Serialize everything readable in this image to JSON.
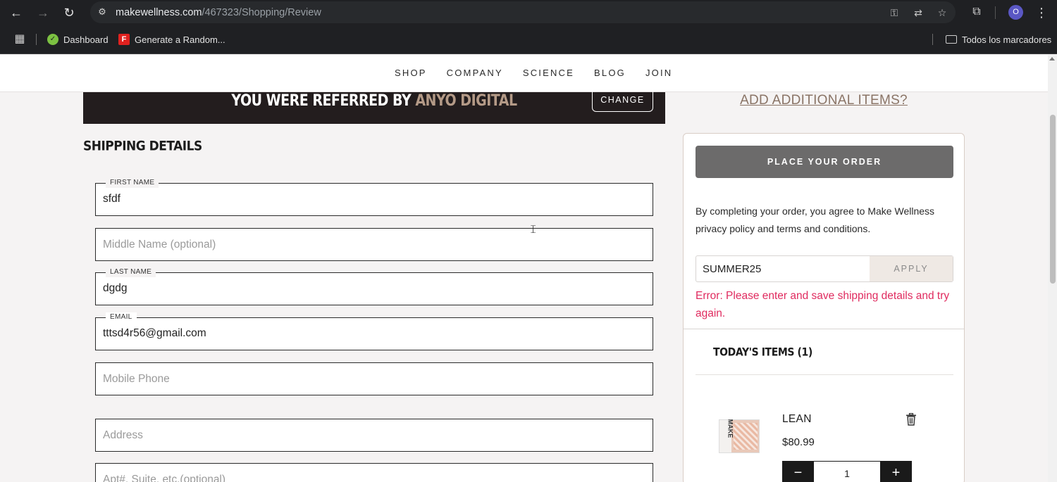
{
  "browser": {
    "url_host": "makewellness.com",
    "url_path": "/467323/Shopping/Review",
    "avatar_letter": "O",
    "bookmarks": [
      {
        "label": "Dashboard"
      },
      {
        "label": "Generate a Random..."
      }
    ],
    "bookmark_folder": "Todos los marcadores"
  },
  "site_nav": {
    "links": [
      "SHOP",
      "COMPANY",
      "SCIENCE",
      "BLOG",
      "JOIN"
    ]
  },
  "referral": {
    "prefix": "YOU WERE REFERRED BY ",
    "name": "ANYO DIGITAL",
    "change_label": "CHANGE"
  },
  "shipping": {
    "title": "SHIPPING DETAILS",
    "first_name_label": "FIRST NAME",
    "first_name_value": "sfdf",
    "middle_name_placeholder": "Middle Name (optional)",
    "last_name_label": "LAST NAME",
    "last_name_value": "dgdg",
    "email_label": "EMAIL",
    "email_value": "tttsd4r56@gmail.com",
    "mobile_placeholder": "Mobile Phone",
    "address_placeholder": "Address",
    "apt_placeholder": "Apt#, Suite, etc.(optional)"
  },
  "order": {
    "add_items_label": "ADD ADDITIONAL ITEMS?",
    "place_order_label": "PLACE YOUR ORDER",
    "agreement_text": "By completing your order, you agree to Make Wellness privacy policy and terms and conditions.",
    "promo_code": "SUMMER25",
    "apply_label": "APPLY",
    "error_text": "Error: Please enter and save shipping details and try again.",
    "items_title": "TODAY'S ITEMS (1)",
    "items": [
      {
        "name": "LEAN",
        "price": "$80.99",
        "quantity": "1",
        "package_text": "MAKE"
      }
    ]
  }
}
